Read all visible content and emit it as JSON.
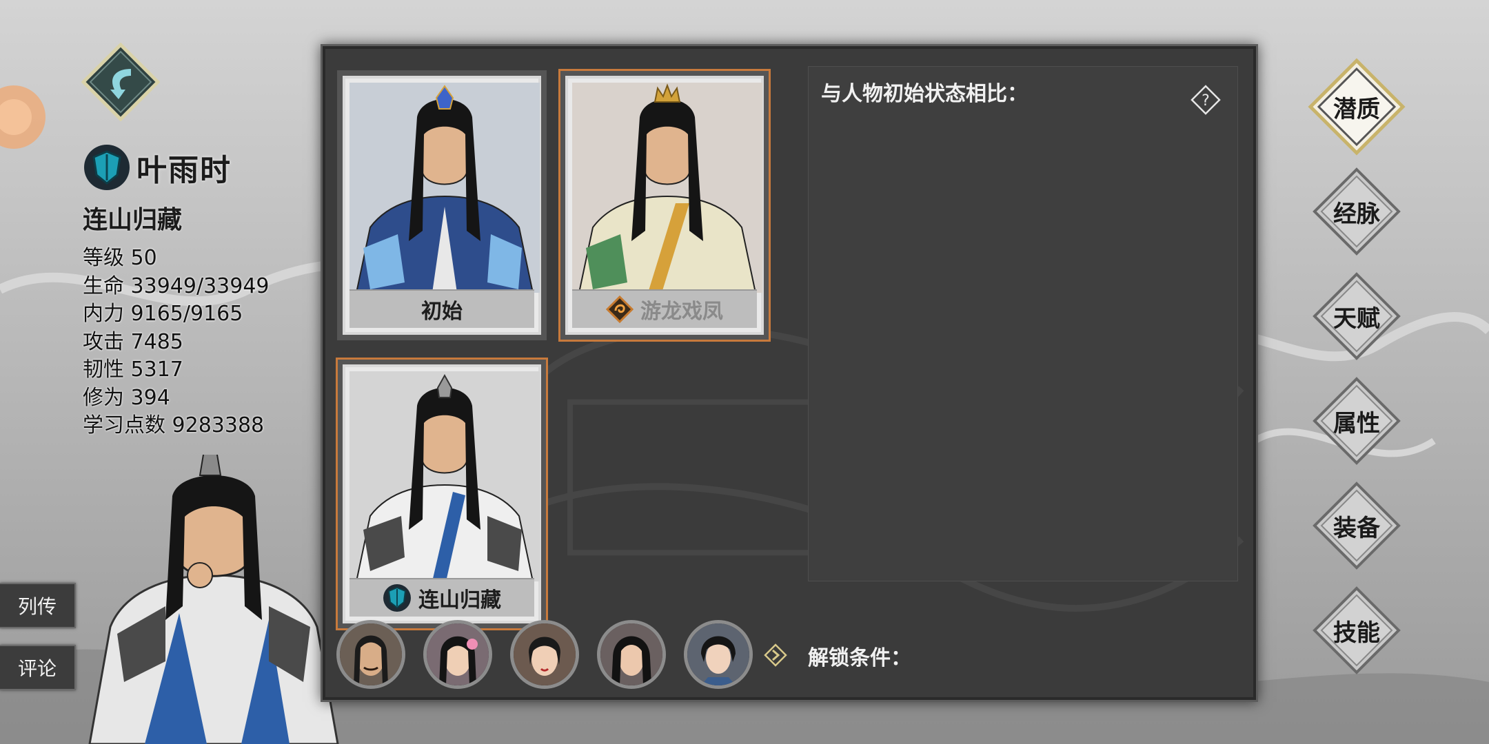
{
  "hero": {
    "name": "叶雨时",
    "title": "连山归藏",
    "stats": [
      "等级 50",
      "生命 33949/33949",
      "内力 9165/9165",
      "攻击 7485",
      "韧性 5317",
      "修为 394",
      "学习点数 9283388"
    ]
  },
  "side_tabs": {
    "liezhuan": "列传",
    "pinglun": "评论"
  },
  "cards": [
    {
      "label": "初始",
      "icon": "none",
      "selected": false,
      "locked": false
    },
    {
      "label": "游龙戏凤",
      "icon": "orange-swirl-icon",
      "selected": true,
      "locked": true
    },
    {
      "label": "连山归藏",
      "icon": "shield-icon",
      "selected": true,
      "locked": false
    }
  ],
  "compare": {
    "title": "与人物初始状态相比：",
    "help": "?"
  },
  "unlock": {
    "label": "解锁条件："
  },
  "nav": [
    "潜质",
    "经脉",
    "天赋",
    "属性",
    "装备",
    "技能"
  ],
  "nav_active": "潜质",
  "colors": {
    "accent": "#c87a3c",
    "panel": "#3b3b3b",
    "shield": "#1c9fb5"
  }
}
